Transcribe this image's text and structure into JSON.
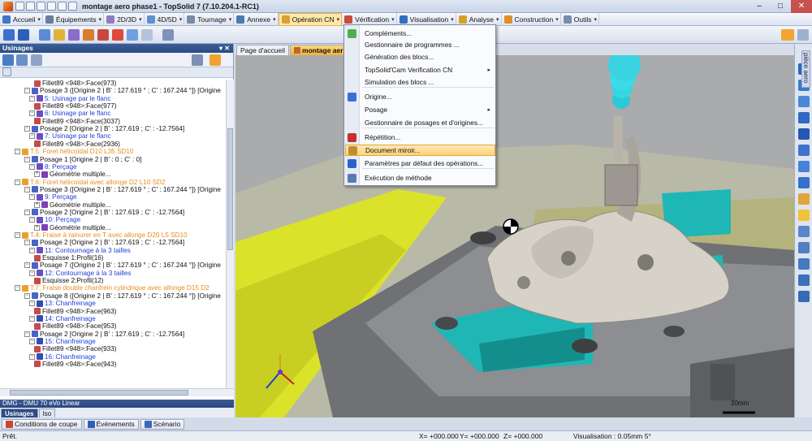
{
  "window": {
    "title": "montage aero  phase1 - TopSolid 7 (7.10.204.1-RC1)",
    "controls": [
      "–",
      "□",
      "✕"
    ]
  },
  "menubar": {
    "items": [
      {
        "label": "Accueil",
        "color": "#3f77c9"
      },
      {
        "label": "Équipements",
        "color": "#6b7ca0"
      },
      {
        "label": "2D/3D",
        "color": "#8f7cc1"
      },
      {
        "label": "4D/5D",
        "color": "#5f8fcf"
      },
      {
        "label": "Tournage",
        "color": "#7a8aa8"
      },
      {
        "label": "Annexe",
        "color": "#4a7ab5"
      },
      {
        "label": "Opération CN",
        "color": "#d9a035"
      },
      {
        "label": "Vérification",
        "color": "#c94b3a"
      },
      {
        "label": "Visualisation",
        "color": "#2f6fc2"
      },
      {
        "label": "Analyse",
        "color": "#d6a12b"
      },
      {
        "label": "Construction",
        "color": "#e48a2a"
      },
      {
        "label": "Outils",
        "color": "#7a8ca9"
      }
    ]
  },
  "left_panel": {
    "title": "Usinages",
    "pin": "▾ ✕",
    "tree": [
      {
        "indent": 7,
        "icon": "face",
        "text": "Fillet89 <948>:Face(973)",
        "style": "normal",
        "exp": ""
      },
      {
        "indent": 5,
        "icon": "posage",
        "text": "Posage 3 ([Origine 2 | B' : 127.619 ° ; C' : 167.244 °]) [Origine",
        "style": "normal",
        "exp": "−"
      },
      {
        "indent": 6,
        "icon": "op",
        "text": "5: Usinage par le flanc",
        "style": "link",
        "exp": "−"
      },
      {
        "indent": 7,
        "icon": "face",
        "text": "Fillet89 <948>:Face(977)",
        "style": "normal",
        "exp": ""
      },
      {
        "indent": 6,
        "icon": "op",
        "text": "6: Usinage par le flanc",
        "style": "link",
        "exp": "−"
      },
      {
        "indent": 7,
        "icon": "face",
        "text": "Fillet89 <948>:Face(3037)",
        "style": "normal",
        "exp": ""
      },
      {
        "indent": 5,
        "icon": "posage",
        "text": "Posage 2 [Origine 2 | B' : 127.619 ; C' : -12.7564]",
        "style": "normal",
        "exp": "−"
      },
      {
        "indent": 6,
        "icon": "op",
        "text": "7: Usinage par le flanc",
        "style": "link",
        "exp": "−"
      },
      {
        "indent": 7,
        "icon": "face",
        "text": "Fillet89 <948>:Face(2936)",
        "style": "normal",
        "exp": ""
      },
      {
        "indent": 3,
        "icon": "tool",
        "text": "T.5: Foret hélicoïdal D10 L35 SD10",
        "style": "tool",
        "exp": "−"
      },
      {
        "indent": 5,
        "icon": "posage",
        "text": "Posage 1 [Origine 2 | B' : 0 ; C' : 0]",
        "style": "normal",
        "exp": "−"
      },
      {
        "indent": 6,
        "icon": "op",
        "text": "8: Perçage",
        "style": "link",
        "exp": "−"
      },
      {
        "indent": 7,
        "icon": "geo",
        "text": "Géométrie multiple...",
        "style": "normal",
        "exp": "+"
      },
      {
        "indent": 3,
        "icon": "tool",
        "text": "T.6: Foret hélicoïdal avec allonge D2 L10 SD2",
        "style": "tool",
        "exp": "−"
      },
      {
        "indent": 5,
        "icon": "posage",
        "text": "Posage 3 ([Origine 2 | B' : 127.619 ° ; C' : 167.244 °]) [Origine",
        "style": "normal",
        "exp": "−"
      },
      {
        "indent": 6,
        "icon": "op",
        "text": "9: Perçage",
        "style": "link",
        "exp": "−"
      },
      {
        "indent": 7,
        "icon": "geo",
        "text": "Géométrie multiple...",
        "style": "normal",
        "exp": "+"
      },
      {
        "indent": 5,
        "icon": "posage",
        "text": "Posage 2 [Origine 2 | B' : 127.619 ; C' : -12.7564]",
        "style": "normal",
        "exp": "−"
      },
      {
        "indent": 6,
        "icon": "op",
        "text": "10: Perçage",
        "style": "link",
        "exp": "−"
      },
      {
        "indent": 7,
        "icon": "geo",
        "text": "Géométrie multiple...",
        "style": "normal",
        "exp": "+"
      },
      {
        "indent": 3,
        "icon": "tool",
        "text": "T.4: Fraise à rainurer en T avec allonge D20 L5 SD10",
        "style": "tool",
        "exp": "−"
      },
      {
        "indent": 5,
        "icon": "posage",
        "text": "Posage 2 [Origine 2 | B' : 127.619 ; C' : -12.7564]",
        "style": "normal",
        "exp": "−"
      },
      {
        "indent": 6,
        "icon": "op",
        "text": "11: Contournage à la 3 tailles",
        "style": "link",
        "exp": "−"
      },
      {
        "indent": 7,
        "icon": "face",
        "text": "Esquisse 1:Profil(16)",
        "style": "normal",
        "exp": ""
      },
      {
        "indent": 5,
        "icon": "posage",
        "text": "Posage 7 ([Origine 2 | B' : 127.619 ° ; C' : 167.244 °]) [Origine",
        "style": "normal",
        "exp": "−"
      },
      {
        "indent": 6,
        "icon": "op",
        "text": "12: Contournage à la 3 tailles",
        "style": "link",
        "exp": "−"
      },
      {
        "indent": 7,
        "icon": "face",
        "text": "Esquisse 2:Profil(12)",
        "style": "normal",
        "exp": ""
      },
      {
        "indent": 3,
        "icon": "tool",
        "text": "T.7: Fraise double chanfrein cylindrique avec allonge D15 D2",
        "style": "tool",
        "exp": "−"
      },
      {
        "indent": 5,
        "icon": "posage",
        "text": "Posage 8 ([Origine 2 | B' : 127.619 ° ; C' : 167.244 °]) [Origine",
        "style": "normal",
        "exp": "−"
      },
      {
        "indent": 6,
        "icon": "op2",
        "text": "13: Chanfreinage",
        "style": "link",
        "exp": "−"
      },
      {
        "indent": 7,
        "icon": "face",
        "text": "Fillet89 <948>:Face(963)",
        "style": "normal",
        "exp": ""
      },
      {
        "indent": 6,
        "icon": "op2",
        "text": "14: Chanfreinage",
        "style": "link",
        "exp": "−"
      },
      {
        "indent": 7,
        "icon": "face",
        "text": "Fillet89 <948>:Face(953)",
        "style": "normal",
        "exp": ""
      },
      {
        "indent": 5,
        "icon": "posage",
        "text": "Posage 2 [Origine 2 | B' : 127.619 ; C' : -12.7564]",
        "style": "normal",
        "exp": "−"
      },
      {
        "indent": 6,
        "icon": "op2",
        "text": "15: Chanfreinage",
        "style": "link",
        "exp": "−"
      },
      {
        "indent": 7,
        "icon": "face",
        "text": "Fillet89 <948>:Face(933)",
        "style": "normal",
        "exp": ""
      },
      {
        "indent": 6,
        "icon": "op2",
        "text": "16: Chanfreinage",
        "style": "link",
        "exp": "−"
      },
      {
        "indent": 7,
        "icon": "face",
        "text": "Fillet89 <948>:Face(943)",
        "style": "normal",
        "exp": ""
      }
    ],
    "machine": "DMG - DMU 70 eVo Linear",
    "bottom_tabs": [
      "Usinages",
      "Iso"
    ]
  },
  "ribbon_tabs": [
    "Conditions de coupe",
    "Événements",
    "Scénario"
  ],
  "doc_tabs": [
    "Page d'accueil",
    "montage aero"
  ],
  "side_tab": "pièce aero",
  "dropdown": {
    "items": [
      {
        "label": "Compléments...",
        "icon_color": "#4caf50",
        "submenu": false,
        "highlight": false
      },
      {
        "label": "Gestionnaire de programmes ...",
        "icon_color": "",
        "submenu": false,
        "highlight": false
      },
      {
        "label": "Génération des blocs...",
        "icon_color": "",
        "submenu": false,
        "highlight": false
      },
      {
        "label": "TopSolid'Cam Verification CN",
        "icon_color": "",
        "submenu": true,
        "highlight": false
      },
      {
        "label": "Simulation des blocs ...",
        "icon_color": "",
        "submenu": false,
        "highlight": false
      },
      {
        "label": "Origine...",
        "icon_color": "#3a6fd8",
        "submenu": false,
        "highlight": false
      },
      {
        "label": "Posage",
        "icon_color": "",
        "submenu": true,
        "highlight": false
      },
      {
        "label": "Gestionnaire de posages et d'origines...",
        "icon_color": "",
        "submenu": false,
        "highlight": false
      },
      {
        "label": "Répétition...",
        "icon_color": "#c7312b",
        "submenu": false,
        "highlight": false
      },
      {
        "label": "Document miroir...",
        "icon_color": "#c28b2e",
        "submenu": false,
        "highlight": true
      },
      {
        "label": "Paramètres par défaut des opérations...",
        "icon_color": "#2a64c9",
        "submenu": false,
        "highlight": false
      },
      {
        "label": "Exécution de méthode",
        "icon_color": "#5a79b0",
        "submenu": false,
        "highlight": false
      }
    ]
  },
  "viewport": {
    "scale_label": "20mm"
  },
  "status": {
    "ready": "Prêt.",
    "x": "X= +000.000",
    "y": "Y= +000.000",
    "z": "Z= +000.000",
    "visualisation": "Visualisation : 0.05mm 5°"
  }
}
